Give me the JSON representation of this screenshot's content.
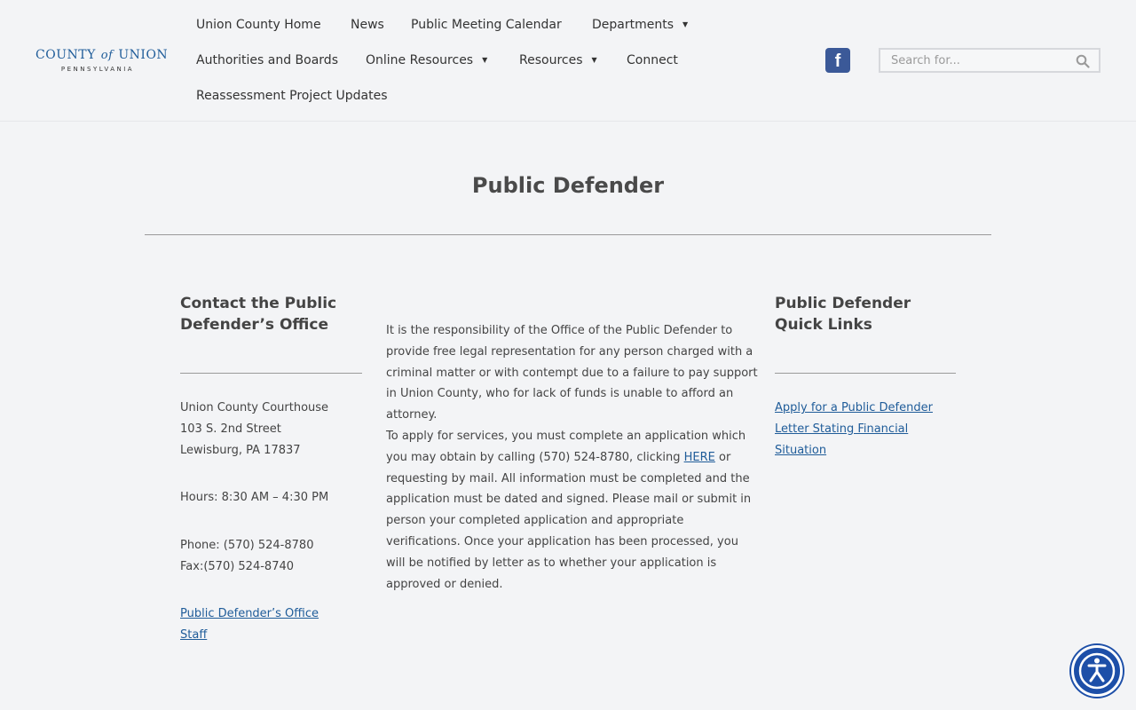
{
  "logo": {
    "county": "COUNTY",
    "of": "of",
    "union": "UNION",
    "state": "PENNSYLVANIA"
  },
  "nav": {
    "home": "Union County Home",
    "news": "News",
    "calendar": "Public Meeting Calendar",
    "departments": "Departments",
    "authorities": "Authorities and Boards",
    "online_resources": "Online Resources",
    "resources": "Resources",
    "connect": "Connect",
    "reassessment": "Reassessment Project Updates"
  },
  "search": {
    "placeholder": "Search for..."
  },
  "page": {
    "title": "Public Defender"
  },
  "contact": {
    "heading_line1": "Contact the Public",
    "heading_line2": "Defender’s Office",
    "address1": "Union County Courthouse",
    "address2": "103 S. 2nd Street",
    "address3": "Lewisburg, PA 17837",
    "hours": "Hours: 8:30 AM – 4:30 PM",
    "phone": "Phone: (570) 524-8780",
    "fax": "Fax:(570) 524-8740",
    "staff_link_line1": "Public Defender’s Office",
    "staff_link_line2": "Staff"
  },
  "main": {
    "para1": "It is the responsibility of the Office of the Public Defender to provide free legal representation for any person charged with a criminal matter or with contempt due to a failure to pay support in Union County, who for lack of funds is unable to afford an attorney.",
    "para2_before": "To apply for services, you must complete an application which you may obtain by calling (570) 524-8780, clicking ",
    "para2_link": "HERE",
    "para2_after": " or requesting by mail. All information must be completed and the application must be dated and signed. Please mail or submit in person your completed application and appropriate verifications. Once your application has been processed, you will be notified by letter as to whether your application is approved or denied."
  },
  "quicklinks": {
    "heading_line1": "Public Defender",
    "heading_line2": "Quick Links",
    "link_line1": "Apply for a Public Defender",
    "link_line2": "Letter Stating Financial",
    "link_line3": "Situation"
  },
  "social": {
    "facebook_glyph": "f"
  },
  "icons": {
    "search": "search-icon",
    "facebook": "facebook-icon",
    "accessibility": "accessibility-icon",
    "caret": "caret-down-icon"
  },
  "colors": {
    "link": "#1f5c99",
    "facebook": "#3b5998",
    "accessibility": "#1d4fa8",
    "background": "#f3f4f6"
  }
}
